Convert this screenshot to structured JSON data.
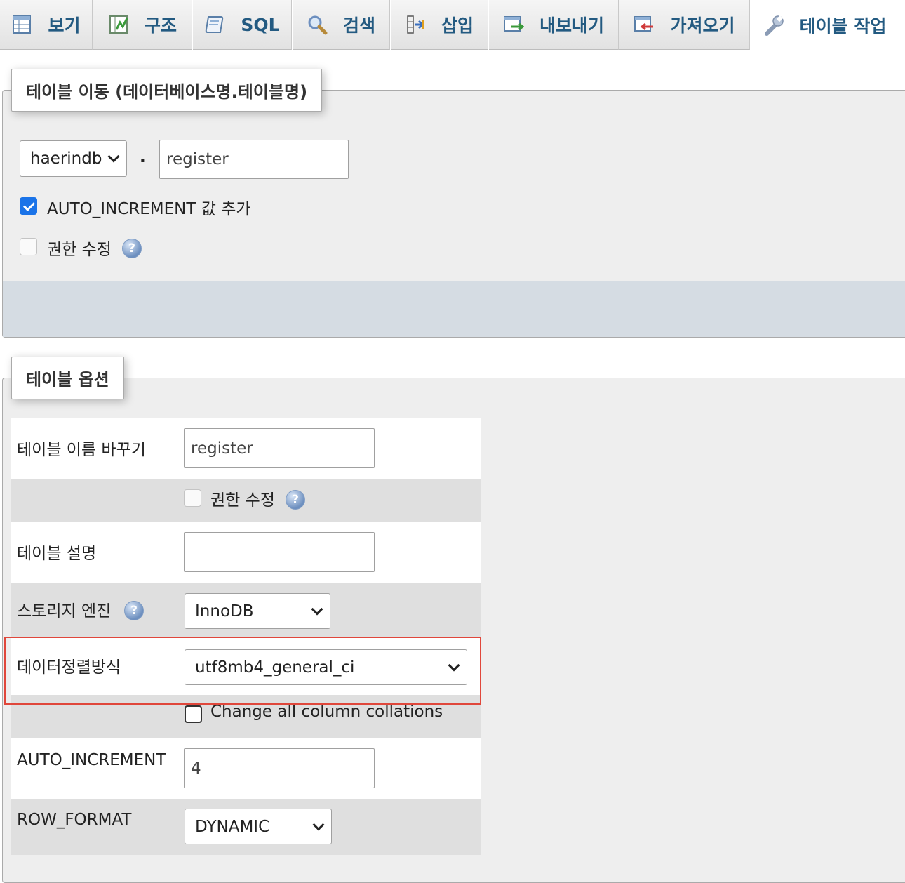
{
  "tabs": [
    {
      "label": "보기",
      "icon": "browse-table-icon"
    },
    {
      "label": "구조",
      "icon": "structure-icon"
    },
    {
      "label": "SQL",
      "icon": "sql-icon"
    },
    {
      "label": "검색",
      "icon": "search-icon"
    },
    {
      "label": "삽입",
      "icon": "insert-icon"
    },
    {
      "label": "내보내기",
      "icon": "export-icon"
    },
    {
      "label": "가져오기",
      "icon": "import-icon"
    },
    {
      "label": "테이블 작업",
      "icon": "wrench-icon",
      "active": true
    }
  ],
  "move_table": {
    "legend": "테이블 이동 (데이터베이스명.테이블명)",
    "database_selected": "haerindb",
    "dot": ".",
    "table_name": "register",
    "auto_increment_label": "AUTO_INCREMENT 값 추가",
    "auto_increment_checked": true,
    "privileges_label": "권한 수정",
    "privileges_checked": false
  },
  "table_options": {
    "legend": "테이블 옵션",
    "rename_label": "테이블 이름 바꾸기",
    "rename_value": "register",
    "privileges_label": "권한 수정",
    "comment_label": "테이블 설명",
    "comment_value": "",
    "engine_label": "스토리지 엔진",
    "engine_selected": "InnoDB",
    "collation_label": "데이터정렬방식",
    "collation_selected": "utf8mb4_general_ci",
    "change_all_collations_label": "Change all column collations",
    "auto_increment_label": "AUTO_INCREMENT",
    "auto_increment_value": "4",
    "row_format_label": "ROW_FORMAT",
    "row_format_selected": "DYNAMIC"
  },
  "colors": {
    "tab_text": "#235a81",
    "panel_bg": "#eeeeee",
    "row_alt": "#dfdfdf",
    "footer_bg": "#d5dce3",
    "highlight": "#e0473b",
    "checkbox_on": "#1a73e8"
  }
}
